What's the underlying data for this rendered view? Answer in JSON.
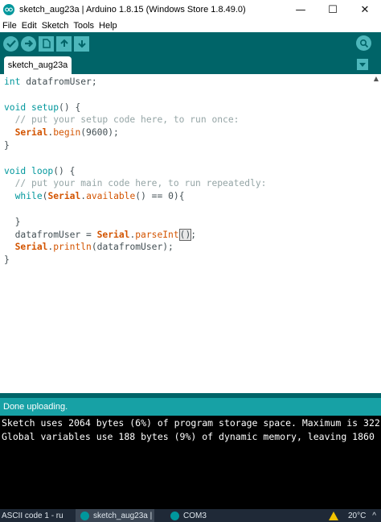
{
  "window": {
    "title": "sketch_aug23a | Arduino 1.8.15 (Windows Store 1.8.49.0)",
    "controls": {
      "minimize": "—",
      "maximize": "☐",
      "close": "✕"
    }
  },
  "menu": {
    "items": [
      "File",
      "Edit",
      "Sketch",
      "Tools",
      "Help"
    ]
  },
  "toolbar": {
    "buttons": [
      "verify-icon",
      "upload-icon",
      "new-icon",
      "open-icon",
      "save-icon"
    ],
    "serial_monitor": "serial-monitor-icon"
  },
  "tabs": {
    "active": "sketch_aug23a"
  },
  "editor": {
    "lines": [
      "int datafromUser;",
      "",
      "void setup() {",
      "  // put your setup code here, to run once:",
      "  Serial.begin(9600);",
      "}",
      "",
      "void loop() {",
      "  // put your main code here, to run repeatedly:",
      "  while(Serial.available() == 0){",
      "",
      "  }",
      "  datafromUser = Serial.parseInt();",
      "  Serial.println(datafromUser);",
      "}"
    ]
  },
  "status": {
    "text": "Done uploading."
  },
  "console": {
    "lines": [
      "Sketch uses 2064 bytes (6%) of program storage space. Maximum is 322",
      "Global variables use 188 bytes (9%) of dynamic memory, leaving 1860"
    ]
  },
  "taskbar": {
    "items": [
      "ASCII code 1 - ru",
      "sketch_aug23a |",
      "COM3"
    ],
    "temperature": "20°C"
  },
  "colors": {
    "toolbar": "#006468",
    "button": "#4db7bb",
    "status": "#17a1a5",
    "keyword": "#00979c",
    "function": "#d35400",
    "comment": "#95a5a6"
  }
}
